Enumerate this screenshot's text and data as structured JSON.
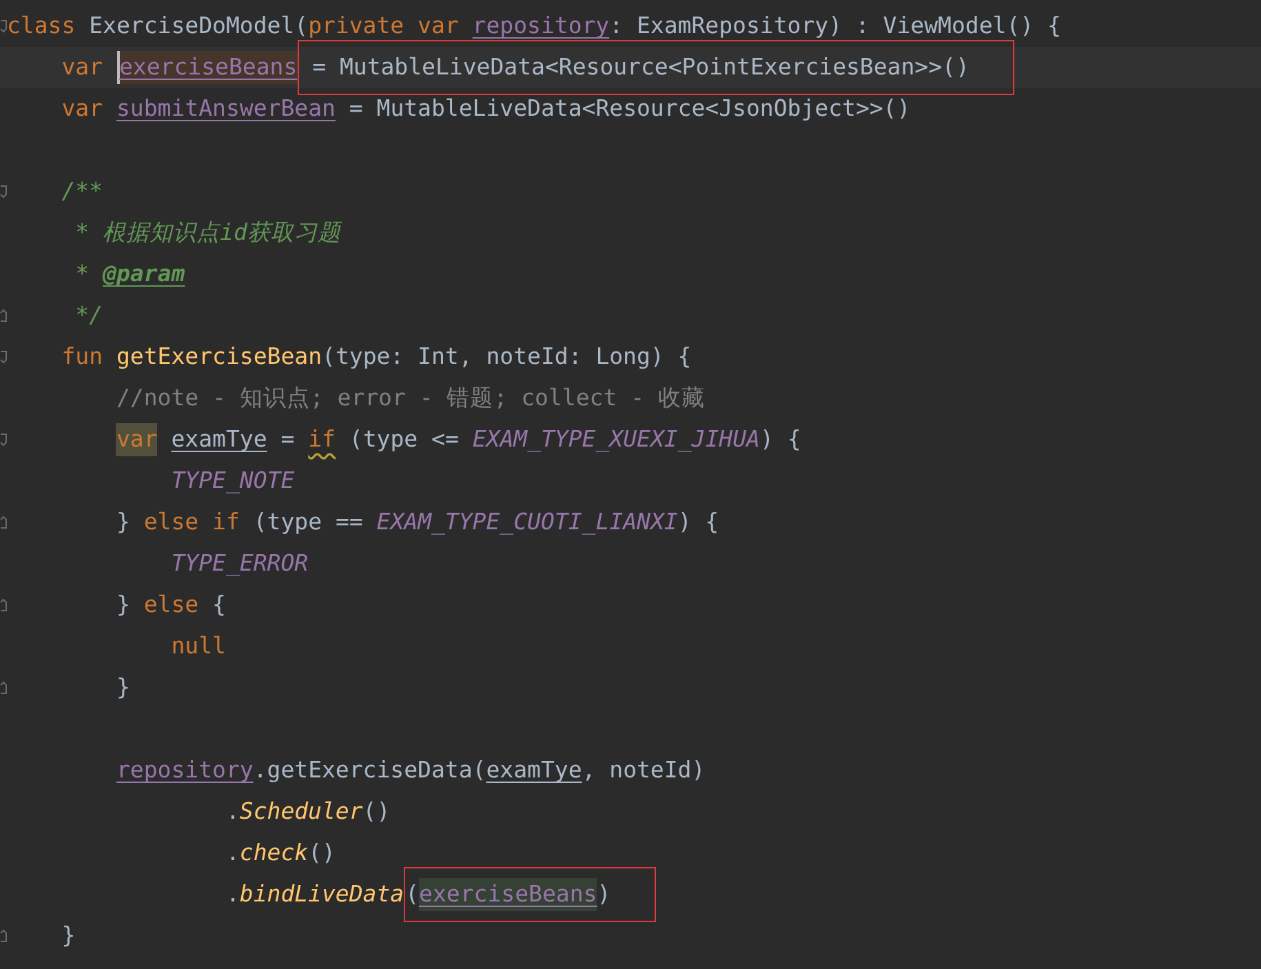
{
  "editor": {
    "lines": [
      {
        "fold_start": true,
        "tokens": [
          {
            "kind": "keyword",
            "text": "class"
          },
          {
            "kind": "text",
            "text": " ExerciseDoModel("
          },
          {
            "kind": "keyword",
            "text": "private var "
          },
          {
            "kind": "field",
            "text": "repository"
          },
          {
            "kind": "text",
            "text": ": ExamRepository) : ViewModel() {"
          }
        ]
      },
      {
        "current": true,
        "tokens": [
          {
            "kind": "keyword",
            "text": "    var "
          },
          {
            "kind": "field",
            "text": "exerciseBeans",
            "write_highlight": true,
            "caret": true
          },
          {
            "kind": "text",
            "text": " = MutableLiveData<Resource<PointExerciesBean>>()",
            "boxed": true
          }
        ]
      },
      {
        "tokens": [
          {
            "kind": "keyword",
            "text": "    var "
          },
          {
            "kind": "field",
            "text": "submitAnswerBean"
          },
          {
            "kind": "text",
            "text": " = MutableLiveData<Resource<JsonObject>>()"
          }
        ]
      },
      {
        "blank_before": true,
        "fold_start": true,
        "tokens": [
          {
            "kind": "doc",
            "text": "    /**"
          }
        ]
      },
      {
        "tokens": [
          {
            "kind": "doc",
            "text": "     * 根据知识点id获取习题"
          }
        ]
      },
      {
        "tokens": [
          {
            "kind": "doc",
            "text": "     * "
          },
          {
            "kind": "doctag",
            "text": "@param"
          }
        ]
      },
      {
        "fold_end": true,
        "tokens": [
          {
            "kind": "doc",
            "text": "     */"
          }
        ]
      },
      {
        "fold_start": true,
        "tokens": [
          {
            "kind": "keyword",
            "text": "    fun "
          },
          {
            "kind": "decl",
            "text": "getExerciseBean"
          },
          {
            "kind": "text",
            "text": "(type: Int, noteId: Long) {"
          }
        ]
      },
      {
        "tokens": [
          {
            "kind": "comment",
            "text": "        //note - 知识点; error - 错题; collect - 收藏"
          }
        ]
      },
      {
        "fold_start": true,
        "tokens": [
          {
            "kind": "keyword",
            "text": "        var",
            "intention_highlight": true
          },
          {
            "kind": "local",
            "text": " examTye"
          },
          {
            "kind": "text",
            "text": " = "
          },
          {
            "kind": "keyword",
            "text": "if",
            "warning": true
          },
          {
            "kind": "text",
            "text": " (type <= "
          },
          {
            "kind": "constant",
            "text": "EXAM_TYPE_XUEXI_JIHUA"
          },
          {
            "kind": "text",
            "text": ") {"
          }
        ]
      },
      {
        "tokens": [
          {
            "kind": "constant",
            "text": "            TYPE_NOTE"
          }
        ]
      },
      {
        "fold_end": true,
        "tokens": [
          {
            "kind": "text",
            "text": "        } "
          },
          {
            "kind": "keyword",
            "text": "else if"
          },
          {
            "kind": "text",
            "text": " (type == "
          },
          {
            "kind": "constant",
            "text": "EXAM_TYPE_CUOTI_LIANXI"
          },
          {
            "kind": "text",
            "text": ") {"
          }
        ]
      },
      {
        "tokens": [
          {
            "kind": "constant",
            "text": "            TYPE_ERROR"
          }
        ]
      },
      {
        "fold_end": true,
        "tokens": [
          {
            "kind": "text",
            "text": "        } "
          },
          {
            "kind": "keyword",
            "text": "else"
          },
          {
            "kind": "text",
            "text": " {"
          }
        ]
      },
      {
        "tokens": [
          {
            "kind": "keyword",
            "text": "            null"
          }
        ]
      },
      {
        "fold_end": true,
        "tokens": [
          {
            "kind": "text",
            "text": "        }"
          }
        ]
      },
      {
        "blank_before": true,
        "tokens": [
          {
            "kind": "field",
            "text": "        repository"
          },
          {
            "kind": "text",
            "text": ".getExerciseData("
          },
          {
            "kind": "local",
            "text": "examTye"
          },
          {
            "kind": "text",
            "text": ", noteId)"
          }
        ]
      },
      {
        "tokens": [
          {
            "kind": "text",
            "text": "                ."
          },
          {
            "kind": "call",
            "text": "Scheduler"
          },
          {
            "kind": "text",
            "text": "()"
          }
        ]
      },
      {
        "tokens": [
          {
            "kind": "text",
            "text": "                ."
          },
          {
            "kind": "call",
            "text": "check"
          },
          {
            "kind": "text",
            "text": "()"
          }
        ]
      },
      {
        "tokens": [
          {
            "kind": "text",
            "text": "                ."
          },
          {
            "kind": "call",
            "text": "bindLiveData"
          },
          {
            "kind": "text",
            "text": "(",
            "boxed": true
          },
          {
            "kind": "field",
            "text": "exerciseBeans",
            "read_highlight": true,
            "boxed": true
          },
          {
            "kind": "text",
            "text": ")",
            "boxed": true
          }
        ]
      },
      {
        "fold_end": true,
        "tokens": [
          {
            "kind": "text",
            "text": "    }"
          }
        ]
      }
    ]
  }
}
